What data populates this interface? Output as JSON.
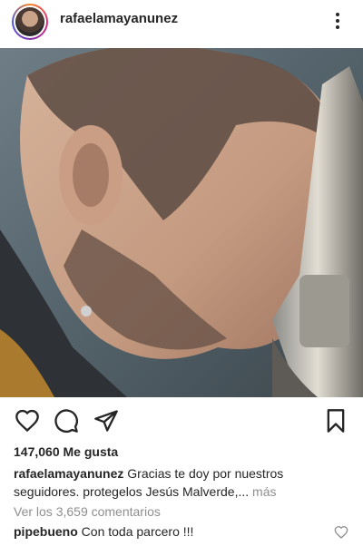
{
  "post": {
    "username": "rafaelamayanunez",
    "likes_text": "147,060 Me gusta",
    "caption_user": "rafaelamayanunez",
    "caption_text": "Gracias te doy por nuestros seguidores.  protegelos Jesús Malverde,...",
    "more_label": "más",
    "view_comments": "Ver los 3,659 comentarios",
    "comment_user": "pipebueno",
    "comment_text": "Con toda parcero !!!"
  },
  "icons": {
    "like": "heart-icon",
    "comment": "comment-icon",
    "share": "send-icon",
    "save": "bookmark-icon",
    "more": "more-vertical-icon"
  },
  "colors": {
    "text": "#262626",
    "muted": "#8e8e8e"
  }
}
